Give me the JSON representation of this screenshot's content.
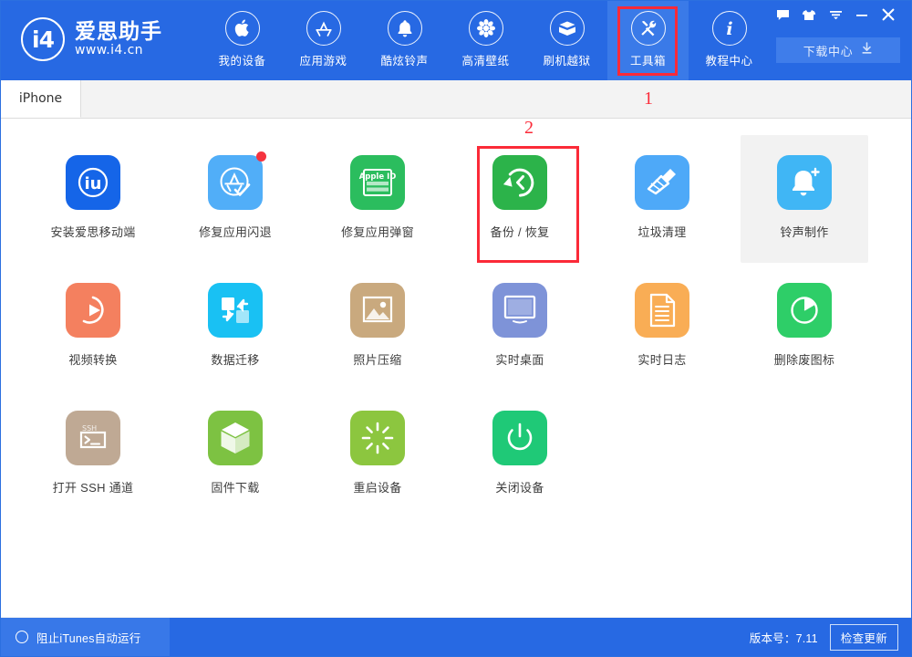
{
  "header": {
    "logo": {
      "mark": "i4",
      "title": "爱思助手",
      "url": "www.i4.cn",
      "icon": "i4-logo-icon"
    },
    "nav": [
      {
        "label": "我的设备",
        "icon": "apple-icon",
        "active": false
      },
      {
        "label": "应用游戏",
        "icon": "appstore-icon",
        "active": false
      },
      {
        "label": "酷炫铃声",
        "icon": "bell-icon",
        "active": false
      },
      {
        "label": "高清壁纸",
        "icon": "flower-icon",
        "active": false
      },
      {
        "label": "刷机越狱",
        "icon": "open-box-icon",
        "active": false
      },
      {
        "label": "工具箱",
        "icon": "wrench-screwdriver-icon",
        "active": true
      },
      {
        "label": "教程中心",
        "icon": "info-icon",
        "active": false
      }
    ],
    "window_controls": [
      {
        "name": "feedback-icon",
        "title": "消息"
      },
      {
        "name": "skin-icon",
        "title": "换肤"
      },
      {
        "name": "menu-icon",
        "title": "菜单"
      },
      {
        "name": "minimize-icon",
        "title": "最小化"
      },
      {
        "name": "close-icon",
        "title": "关闭"
      }
    ],
    "download_center": {
      "label": "下载中心",
      "icon": "download-icon"
    }
  },
  "tabs": [
    {
      "label": "iPhone",
      "active": true
    }
  ],
  "tools": [
    {
      "label": "安装爱思移动端",
      "icon": "i4-app-icon",
      "color": "#1565e8",
      "badge": false,
      "hover": false
    },
    {
      "label": "修复应用闪退",
      "icon": "appstore-fix-icon",
      "color": "#51aef8",
      "badge": true,
      "hover": false
    },
    {
      "label": "修复应用弹窗",
      "icon": "apple-id-icon",
      "color": "#2bbd5e",
      "badge": false,
      "hover": false
    },
    {
      "label": "备份 / 恢复",
      "icon": "restore-icon",
      "color": "#2cb34a",
      "badge": false,
      "hover": false
    },
    {
      "label": "垃圾清理",
      "icon": "broom-icon",
      "color": "#4ea9f8",
      "badge": false,
      "hover": false
    },
    {
      "label": "铃声制作",
      "icon": "bell-plus-icon",
      "color": "#40b6f5",
      "badge": false,
      "hover": true
    },
    {
      "label": "视频转换",
      "icon": "play-circle-icon",
      "color": "#f4805f",
      "badge": false,
      "hover": false
    },
    {
      "label": "数据迁移",
      "icon": "migrate-icon",
      "color": "#19c1f3",
      "badge": false,
      "hover": false
    },
    {
      "label": "照片压缩",
      "icon": "photo-icon",
      "color": "#c9a97e",
      "badge": false,
      "hover": false
    },
    {
      "label": "实时桌面",
      "icon": "monitor-icon",
      "color": "#7e93d8",
      "badge": false,
      "hover": false
    },
    {
      "label": "实时日志",
      "icon": "document-icon",
      "color": "#f9ad55",
      "badge": false,
      "hover": false
    },
    {
      "label": "删除废图标",
      "icon": "pie-icon",
      "color": "#2ece68",
      "badge": false,
      "hover": false
    },
    {
      "label": "打开 SSH 通道",
      "icon": "ssh-terminal-icon",
      "color": "#bba branch",
      "badge": false,
      "hover": false
    },
    {
      "label": "固件下载",
      "icon": "cube-icon",
      "color": "#7dc242",
      "badge": false,
      "hover": false
    },
    {
      "label": "重启设备",
      "icon": "restart-icon",
      "color": "#8cc63f",
      "badge": false,
      "hover": false
    },
    {
      "label": "关闭设备",
      "icon": "power-icon",
      "color": "#1fc977",
      "badge": false,
      "hover": false
    }
  ],
  "annotations": [
    {
      "number": "1",
      "target": "工具箱"
    },
    {
      "number": "2",
      "target": "备份 / 恢复"
    }
  ],
  "statusbar": {
    "block_itunes_label": "阻止iTunes自动运行",
    "block_itunes_icon": "circle-toggle-icon",
    "version_label": "版本号：7.11",
    "update_button": "检查更新"
  },
  "colors": {
    "header_blue": "#2769e3",
    "header_blue_active": "#3a7ae8",
    "annotation_red": "#fb2a38",
    "status_left_blue": "#3878e8"
  }
}
